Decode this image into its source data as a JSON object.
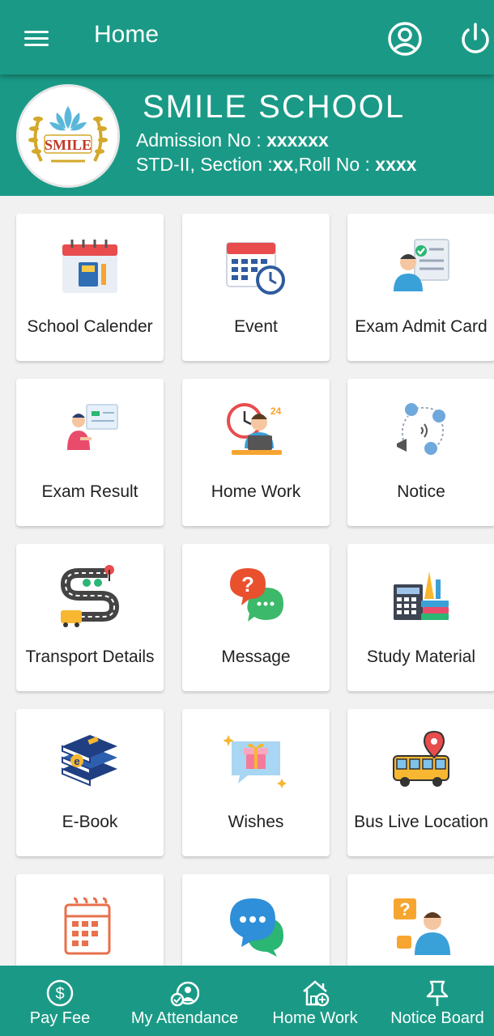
{
  "header": {
    "title": "Home"
  },
  "profile": {
    "school_name": "SMILE SCHOOL",
    "logo_text": "SMILE",
    "admission_label": "Admission No : ",
    "admission_value": "xxxxxx",
    "std_label": "STD-II, Section :",
    "section_value": "xx",
    "roll_label": ",Roll No : ",
    "roll_value": "xxxx"
  },
  "tiles": [
    {
      "label": "School Calender",
      "icon": "school-calendar-icon"
    },
    {
      "label": "Event",
      "icon": "event-calendar-icon"
    },
    {
      "label": "Exam Admit Card",
      "icon": "admit-card-icon"
    },
    {
      "label": "Exam Result",
      "icon": "exam-result-icon"
    },
    {
      "label": "Home Work",
      "icon": "homework-icon"
    },
    {
      "label": "Notice",
      "icon": "notice-icon"
    },
    {
      "label": "Transport Details",
      "icon": "transport-icon"
    },
    {
      "label": "Message",
      "icon": "message-icon"
    },
    {
      "label": "Study Material",
      "icon": "study-material-icon"
    },
    {
      "label": "E-Book",
      "icon": "ebook-icon"
    },
    {
      "label": "Wishes",
      "icon": "wishes-icon"
    },
    {
      "label": "Bus Live Location",
      "icon": "bus-location-icon"
    },
    {
      "label": "",
      "icon": "calendar-icon"
    },
    {
      "label": "",
      "icon": "chat-icon"
    },
    {
      "label": "",
      "icon": "help-icon"
    }
  ],
  "bottom_nav": [
    {
      "label": "Pay Fee",
      "icon": "dollar-icon"
    },
    {
      "label": "My Attendance",
      "icon": "attendance-icon"
    },
    {
      "label": "Home Work",
      "icon": "house-add-icon"
    },
    {
      "label": "Notice Board",
      "icon": "pin-icon"
    }
  ],
  "colors": {
    "primary": "#1a9a86",
    "background": "#f1f1f1",
    "card": "#ffffff"
  }
}
